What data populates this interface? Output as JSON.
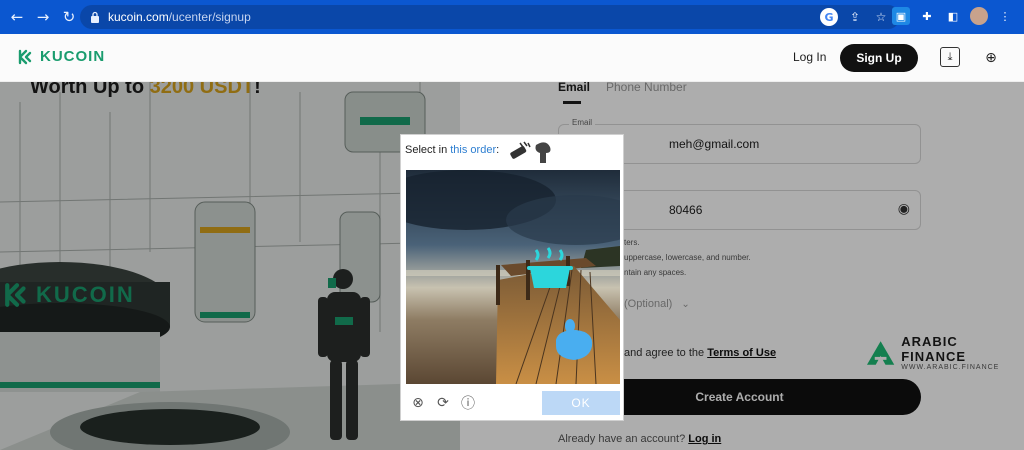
{
  "browser": {
    "url_host": "kucoin.com",
    "url_path": "/ucenter/signup"
  },
  "header": {
    "logo": "KUCOIN",
    "login": "Log In",
    "signup": "Sign Up"
  },
  "promo": {
    "title_prefix": "Worth Up to ",
    "title_amount": "3200 USDT",
    "title_suffix": "!",
    "sign_text": "KUCOIN"
  },
  "form": {
    "tab_email": "Email",
    "tab_phone": "Phone Number",
    "email_label": "Email",
    "email_value": "meh@gmail.com",
    "password_value": "80466",
    "hints": [
      "ters.",
      "uppercase, lowercase, and number.",
      "ntain any spaces."
    ],
    "referral": "(Optional)",
    "terms_text": "and agree to the ",
    "terms_link": "Terms of Use",
    "create_button": "Create Account",
    "already_text": "Already have an account? ",
    "login_link": "Log in"
  },
  "watermark": {
    "name": "ARABIC FINANCE",
    "url": "WWW.ARABIC.FINANCE"
  },
  "captcha": {
    "prompt_prefix": "Select in ",
    "prompt_highlight": "this order",
    "prompt_suffix": ":",
    "ok_button": "OK"
  },
  "colors": {
    "chrome": "#0b57d0",
    "brand": "#1a9c6e",
    "accent_gold": "#d5a11c",
    "captcha_link": "#2f7fd1",
    "ok_button": "#bcd8f6"
  }
}
